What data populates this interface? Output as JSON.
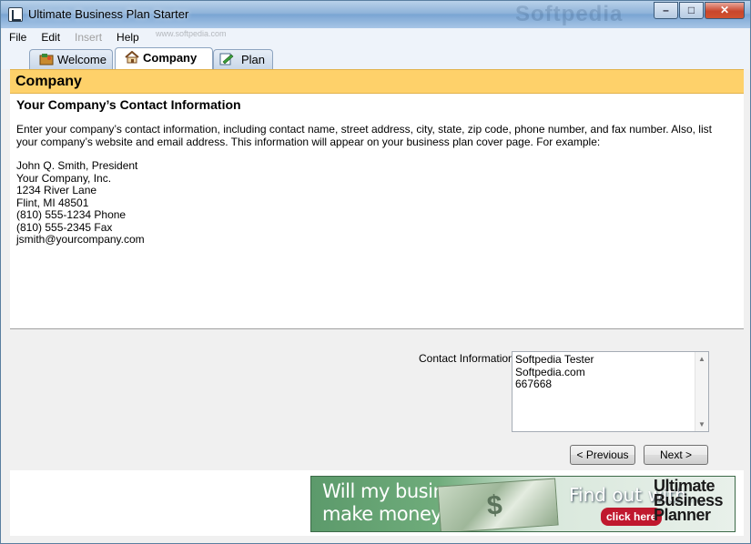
{
  "window": {
    "title": "Ultimate Business Plan Starter",
    "watermark": "Softpedia",
    "controls": {
      "minimize": "–",
      "maximize": "□",
      "close": "✕"
    }
  },
  "menu": {
    "items": [
      {
        "label": "File",
        "enabled": true
      },
      {
        "label": "Edit",
        "enabled": true
      },
      {
        "label": "Insert",
        "enabled": false
      },
      {
        "label": "Help",
        "enabled": true
      }
    ]
  },
  "tabs": {
    "welcome": "Welcome",
    "company": "Company",
    "plan": "Plan",
    "watermark": "www.softpedia.com"
  },
  "header": {
    "title": "Company"
  },
  "content": {
    "section_title": "Your Company’s Contact Information",
    "instructions": "Enter your company’s contact information, including contact name, street address, city, state, zip code, phone number, and fax number. Also, list your company’s website and email address. This information will appear on your business plan cover page. For example:",
    "example": [
      "John Q. Smith, President",
      "Your Company, Inc.",
      "1234 River Lane",
      "Flint, MI 48501",
      "(810) 555-1234 Phone",
      "(810) 555-2345 Fax",
      "jsmith@yourcompany.com"
    ]
  },
  "form": {
    "contact_label": "Contact Information:",
    "contact_value": "Softpedia Tester\nSoftpedia.com\n667668"
  },
  "nav": {
    "previous": "< Previous",
    "next": "Next >"
  },
  "banner": {
    "line1": "Will my business",
    "line2": "make money?",
    "find_out": "Find out with...",
    "click": "click here",
    "product": "Ultimate Business Planner"
  },
  "colors": {
    "header_bg": "#fed16a",
    "titlebar": "#8fb3d9",
    "banner_green": "#5c9a6b"
  }
}
